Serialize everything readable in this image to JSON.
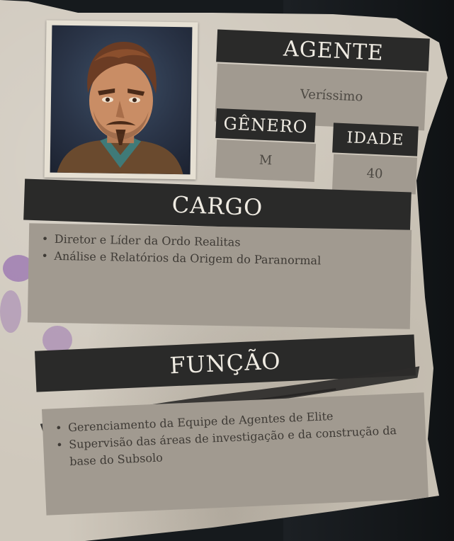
{
  "agent": {
    "label": "AGENTE",
    "value": "Veríssimo"
  },
  "gender": {
    "label": "GÊNERO",
    "value": "M"
  },
  "age": {
    "label": "IDADE",
    "value": "40"
  },
  "cargo": {
    "title": "CARGO",
    "items": [
      "Diretor e Líder da Ordo Realitas",
      "Análise e Relatórios da Origem do Paranormal"
    ]
  },
  "funcao": {
    "title": "FUNÇÃO",
    "items": [
      "Gerenciamento da Equipe de Agentes de Elite",
      "Supervisão das áreas de investigação e da construção da base do Subsolo"
    ]
  },
  "colors": {
    "paper": "#cfc8bc",
    "header_dark": "#2a2a29",
    "field_gray": "#a19a90",
    "stain_purple": "#8250aa"
  },
  "icons": {
    "portrait": "agent-portrait-icon"
  }
}
